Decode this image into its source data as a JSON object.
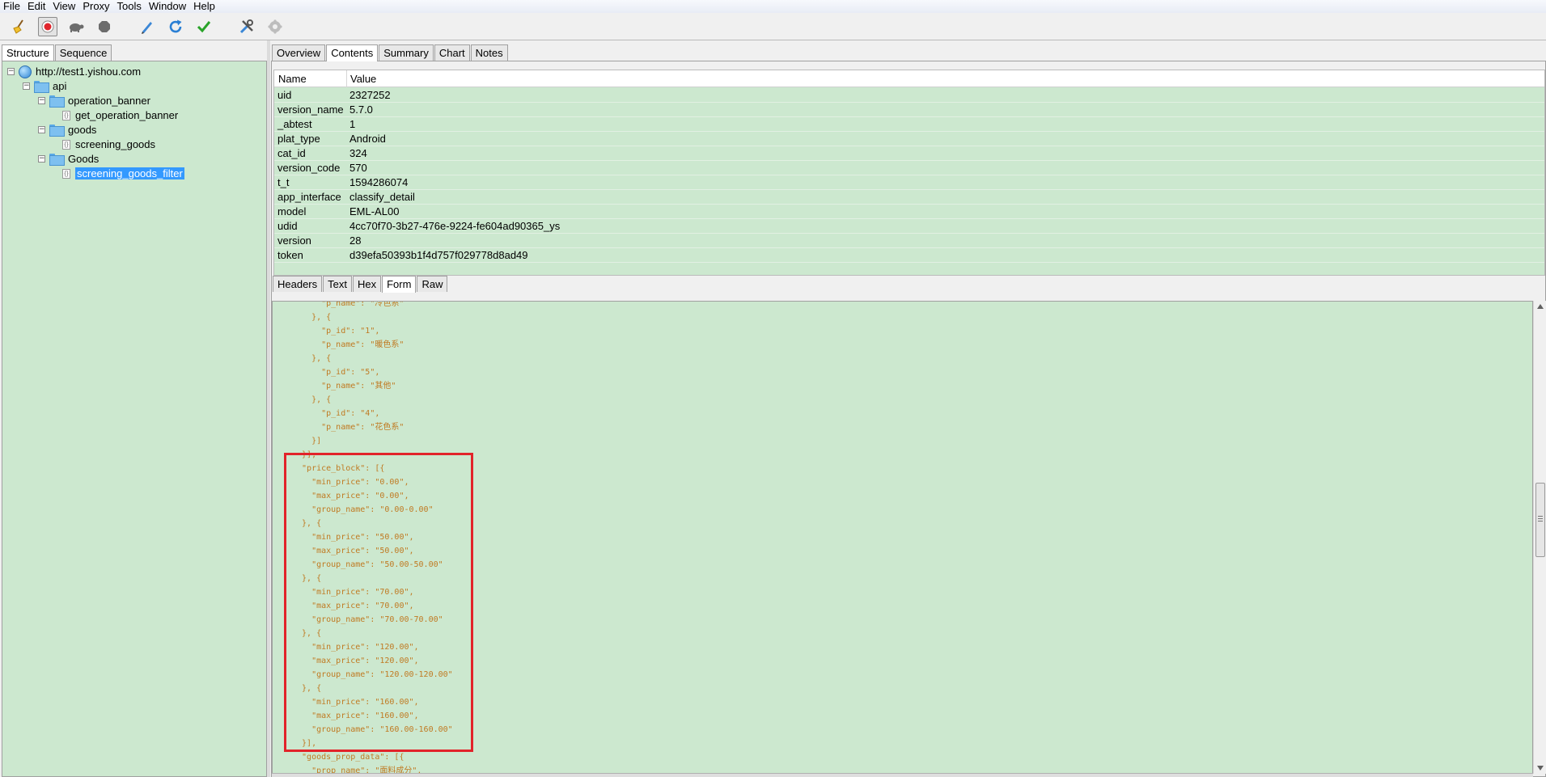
{
  "menu": [
    "File",
    "Edit",
    "View",
    "Proxy",
    "Tools",
    "Window",
    "Help"
  ],
  "toolbar": {
    "icons": [
      "broom-icon",
      "record-icon",
      "turtle-icon",
      "breakpoint-icon",
      "pen-icon",
      "refresh-icon",
      "check-icon",
      "tools-icon",
      "settings-icon"
    ],
    "accent": "#e0262d"
  },
  "left": {
    "tabs": [
      "Structure",
      "Sequence"
    ],
    "active_tab": "Structure",
    "tree": [
      {
        "label": "http://test1.yishou.com",
        "type": "host",
        "level": 0,
        "expanded": true
      },
      {
        "label": "api",
        "type": "folder",
        "level": 1,
        "expanded": true
      },
      {
        "label": "operation_banner",
        "type": "folder",
        "level": 2,
        "expanded": true
      },
      {
        "label": "get_operation_banner",
        "type": "file",
        "level": 3
      },
      {
        "label": "goods",
        "type": "folder",
        "level": 2,
        "expanded": true
      },
      {
        "label": "screening_goods",
        "type": "file",
        "level": 3
      },
      {
        "label": "Goods",
        "type": "folder",
        "level": 2,
        "expanded": true
      },
      {
        "label": "screening_goods_filter",
        "type": "file",
        "level": 3,
        "selected": true
      }
    ]
  },
  "right": {
    "tabs": [
      "Overview",
      "Contents",
      "Summary",
      "Chart",
      "Notes"
    ],
    "active_tab": "Contents",
    "table": {
      "headers": [
        "Name",
        "Value"
      ],
      "rows": [
        [
          "uid",
          "2327252"
        ],
        [
          "version_name",
          "5.7.0"
        ],
        [
          "_abtest",
          "1"
        ],
        [
          "plat_type",
          "Android"
        ],
        [
          "cat_id",
          "324"
        ],
        [
          "version_code",
          "570"
        ],
        [
          "t_t",
          "1594286074"
        ],
        [
          "app_interface",
          "classify_detail"
        ],
        [
          "model",
          "EML-AL00"
        ],
        [
          "udid",
          "4cc70f70-3b27-476e-9224-fe604ad90365_ys"
        ],
        [
          "version",
          "28"
        ],
        [
          "token",
          "d39efa50393b1f4d757f029778d8ad49"
        ]
      ]
    },
    "sub_tabs": [
      "Headers",
      "Text",
      "Hex",
      "Form",
      "Raw"
    ],
    "active_sub_tab": "Form",
    "json_lines": [
      "      \"p_name\": \"冷色系\"",
      "    }, {",
      "      \"p_id\": \"1\",",
      "      \"p_name\": \"暖色系\"",
      "    }, {",
      "      \"p_id\": \"5\",",
      "      \"p_name\": \"其他\"",
      "    }, {",
      "      \"p_id\": \"4\",",
      "      \"p_name\": \"花色系\"",
      "    }]",
      "  }],",
      "  \"price_block\": [{",
      "    \"min_price\": \"0.00\",",
      "    \"max_price\": \"0.00\",",
      "    \"group_name\": \"0.00-0.00\"",
      "  }, {",
      "    \"min_price\": \"50.00\",",
      "    \"max_price\": \"50.00\",",
      "    \"group_name\": \"50.00-50.00\"",
      "  }, {",
      "    \"min_price\": \"70.00\",",
      "    \"max_price\": \"70.00\",",
      "    \"group_name\": \"70.00-70.00\"",
      "  }, {",
      "    \"min_price\": \"120.00\",",
      "    \"max_price\": \"120.00\",",
      "    \"group_name\": \"120.00-120.00\"",
      "  }, {",
      "    \"min_price\": \"160.00\",",
      "    \"max_price\": \"160.00\",",
      "    \"group_name\": \"160.00-160.00\"",
      "  }],",
      "  \"goods_prop_data\": [{",
      "    \"prop_name\": \"面料成分\","
    ]
  },
  "colors": {
    "panel_bg": "#cce8cf",
    "json_text": "#c07a22",
    "selection": "#3399ff",
    "highlight": "#e2232a"
  }
}
